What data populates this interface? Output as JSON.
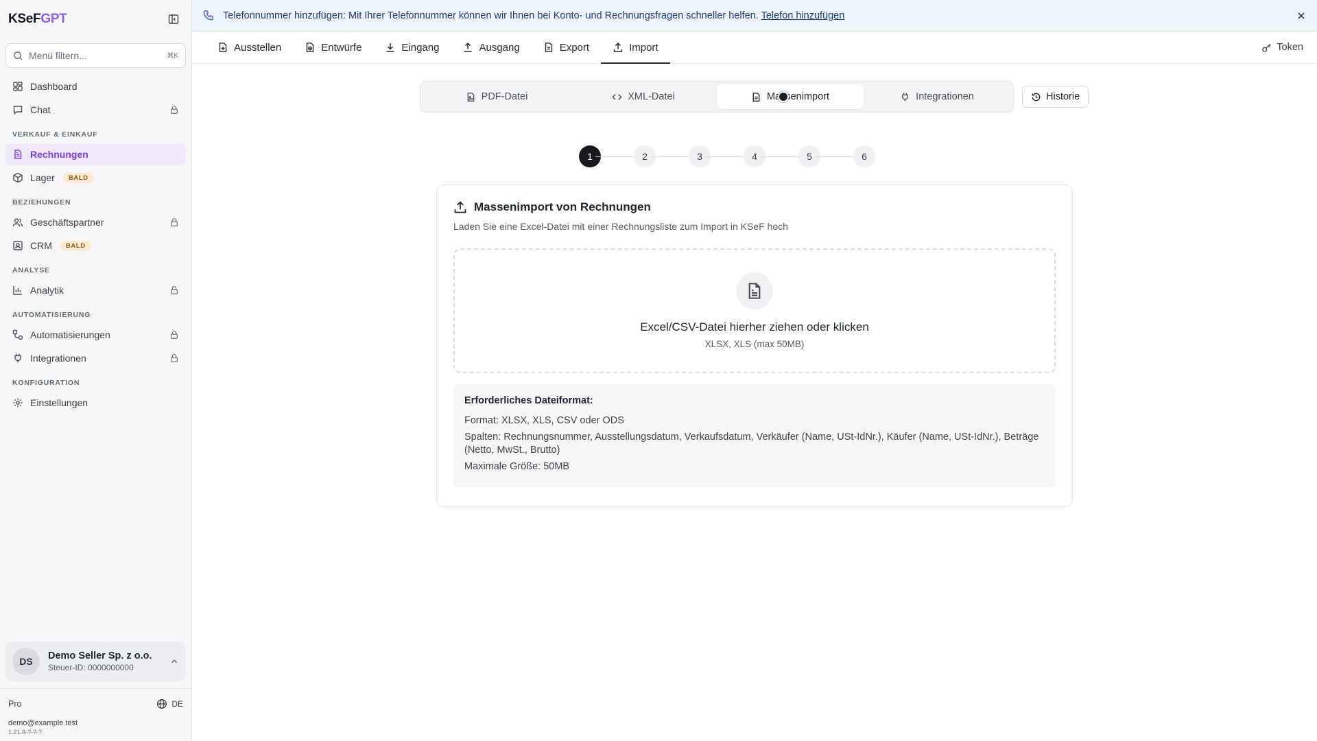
{
  "brand": {
    "part1": "KSeF",
    "part2": "GPT"
  },
  "sidebar": {
    "search_placeholder": "Menü filtern...",
    "search_shortcut": "⌘K",
    "top_items": [
      {
        "label": "Dashboard"
      },
      {
        "label": "Chat"
      }
    ],
    "sections": [
      {
        "title": "VERKAUF & EINKAUF",
        "items": [
          {
            "label": "Rechnungen"
          },
          {
            "label": "Lager",
            "badge": "BALD"
          }
        ]
      },
      {
        "title": "BEZIEHUNGEN",
        "items": [
          {
            "label": "Geschäftspartner"
          },
          {
            "label": "CRM",
            "badge": "BALD"
          }
        ]
      },
      {
        "title": "ANALYSE",
        "items": [
          {
            "label": "Analytik"
          }
        ]
      },
      {
        "title": "AUTOMATISIERUNG",
        "items": [
          {
            "label": "Automatisierungen"
          },
          {
            "label": "Integrationen"
          }
        ]
      },
      {
        "title": "KONFIGURATION",
        "items": [
          {
            "label": "Einstellungen"
          }
        ]
      }
    ],
    "account": {
      "initials": "DS",
      "name": "Demo Seller Sp. z o.o.",
      "tax_id": "Steuer-ID: 0000000000"
    },
    "plan": "Pro",
    "language": "DE",
    "email": "demo@example.test",
    "version": "1.21.8-?-?-?"
  },
  "banner": {
    "text": "Telefonnummer hinzufügen: Mit Ihrer Telefonnummer können wir Ihnen bei Konto- und Rechnungsfragen schneller helfen.",
    "link": "Telefon hinzufügen"
  },
  "topnav": {
    "tabs": [
      {
        "label": "Ausstellen"
      },
      {
        "label": "Entwürfe"
      },
      {
        "label": "Eingang"
      },
      {
        "label": "Ausgang"
      },
      {
        "label": "Export"
      },
      {
        "label": "Import"
      }
    ],
    "active_tab": "Import",
    "token_label": "Token"
  },
  "import_tabs": {
    "items": [
      {
        "label": "PDF-Datei"
      },
      {
        "label": "XML-Datei"
      },
      {
        "label": "Massenimport"
      },
      {
        "label": "Integrationen"
      }
    ],
    "active": "Massenimport",
    "history_label": "Historie"
  },
  "stepper": {
    "steps": [
      "1",
      "2",
      "3",
      "4",
      "5",
      "6"
    ],
    "current": 1
  },
  "card": {
    "title": "Massenimport von Rechnungen",
    "subtitle": "Laden Sie eine Excel-Datei mit einer Rechnungsliste zum Import in KSeF hoch",
    "dropzone_title": "Excel/CSV-Datei hierher ziehen oder klicken",
    "dropzone_sub": "XLSX, XLS (max 50MB)",
    "format_title": "Erforderliches Dateiformat:",
    "format_lines": [
      "Format: XLSX, XLS, CSV oder ODS",
      "Spalten: Rechnungsnummer, Ausstellungsdatum, Verkaufsdatum, Verkäufer (Name, USt-IdNr.), Käufer (Name, USt-IdNr.), Beträge (Netto, MwSt., Brutto)",
      "Maximale Größe: 50MB"
    ]
  },
  "colors": {
    "accent": "#7c3aed",
    "active_bg": "#f0e9fd",
    "banner_bg": "#eef4fb",
    "badge_bg": "#fbe9d0"
  }
}
